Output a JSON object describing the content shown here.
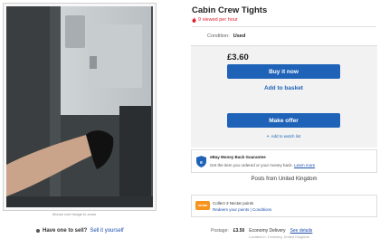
{
  "listing": {
    "title": "Cabin Crew Tights",
    "viewed": "9 viewed per hour",
    "condition_label": "Condition:",
    "condition_value": "Used"
  },
  "gallery": {
    "zoom_hint": "Mouse over image to zoom"
  },
  "sell_bar": {
    "question": "Have one to sell?",
    "link": "Sell it yourself"
  },
  "buy_box": {
    "price": "£3.60",
    "buy_label": "Buy it now",
    "basket_label": "Add to basket",
    "offer_label": "Make offer",
    "watch_label": "Add to watch list"
  },
  "guarantee": {
    "title": "eBay Money Back Guarantee",
    "text": "Get the item you ordered or your money back.",
    "link": "Learn more"
  },
  "location": {
    "text": "Posts from United Kingdom"
  },
  "nectar": {
    "logo_text": "nectar",
    "line1": "Collect 3 Nectar points",
    "line2": "Redeem your points | Conditions"
  },
  "postage": {
    "label": "Postage:",
    "price": "£3.50",
    "method": "Economy Delivery",
    "details_link": "See details",
    "sub": "Located in: Coventry, United Kingdom"
  },
  "colors": {
    "accent": "#1f63b8",
    "alert": "#dd1e31",
    "nectar": "#f7941d"
  }
}
